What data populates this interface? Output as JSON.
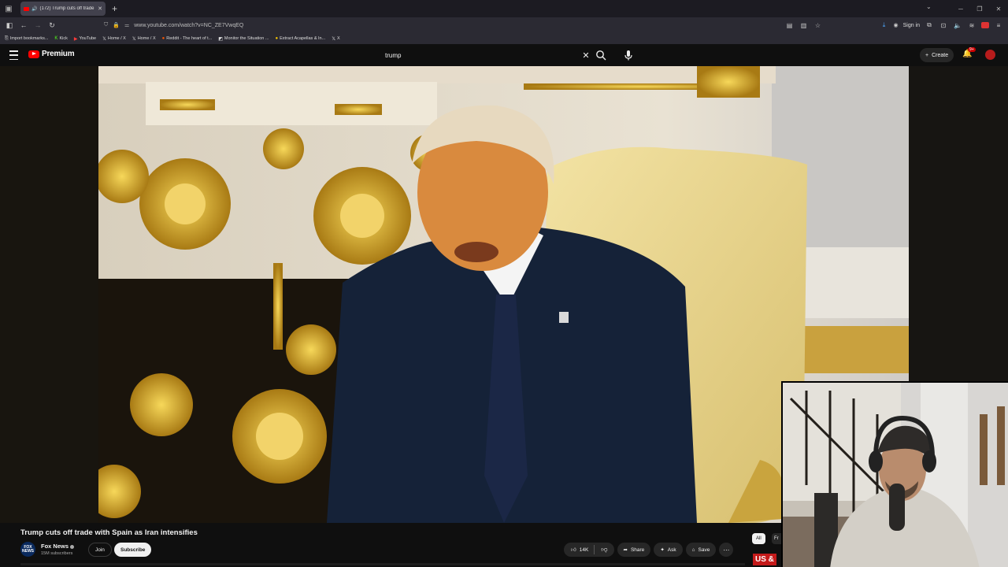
{
  "browser": {
    "tab_title": "(172) Trump cuts off trade",
    "url": "www.youtube.com/watch?v=NC_ZE7VwqEQ",
    "sign_in": "Sign in",
    "bookmarks": [
      {
        "label": "Import bookmarks...",
        "icon": "import-icon"
      },
      {
        "label": "Kick",
        "icon": "kick-icon"
      },
      {
        "label": "YouTube",
        "icon": "youtube-icon"
      },
      {
        "label": "Home / X",
        "icon": "x-icon"
      },
      {
        "label": "Home / X",
        "icon": "x-icon"
      },
      {
        "label": "Reddit - The heart of t...",
        "icon": "reddit-icon"
      },
      {
        "label": "Monitor the Situation ...",
        "icon": "monitor-icon"
      },
      {
        "label": "Extract Acapellas & In...",
        "icon": "extract-icon"
      },
      {
        "label": "X",
        "icon": "x-icon"
      }
    ]
  },
  "youtube": {
    "logo_text": "Premium",
    "search_query": "trump",
    "create_label": "Create",
    "notification_count": "9+"
  },
  "video": {
    "title": "Trump cuts off trade with Spain as Iran intensifies",
    "channel_name": "Fox News",
    "channel_avatar_text": "FOX NEWS",
    "subscribers": "15M subscribers",
    "join_label": "Join",
    "subscribe_label": "Subscribe",
    "likes": "14K",
    "share_label": "Share",
    "ask_label": "Ask",
    "save_label": "Save",
    "chip_all": "All",
    "chip_next": "Fr",
    "overlay_text": "US &"
  }
}
